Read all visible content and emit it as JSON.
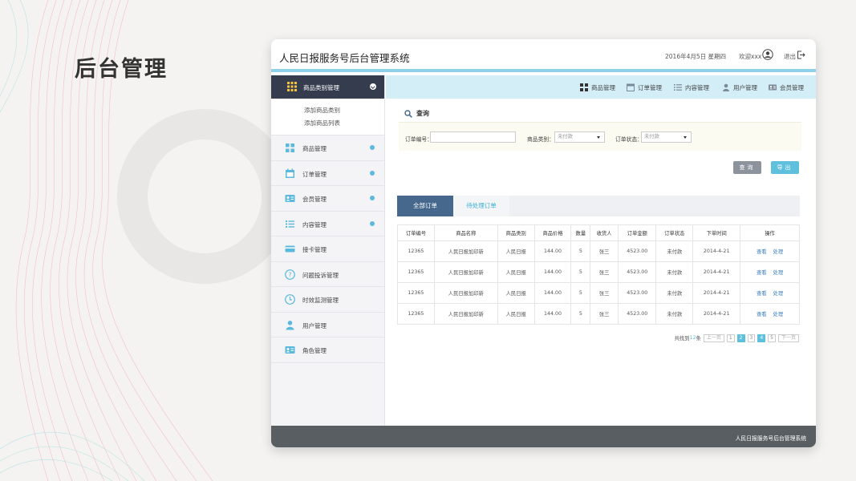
{
  "slide": {
    "title": "后台管理"
  },
  "app": {
    "title": "人民日报服务号后台管理系统",
    "date": "2016年4月5日 星期四",
    "welcome": "欢迎xxx",
    "logout": "退出"
  },
  "sidebar": {
    "active": {
      "label": "商品类别管理",
      "icon": "grid-icon"
    },
    "sub_items": [
      {
        "label": "添加商品类别"
      },
      {
        "label": "添加商品列表"
      }
    ],
    "items": [
      {
        "label": "商品管理",
        "icon": "apps-icon"
      },
      {
        "label": "订单管理",
        "icon": "calendar-icon"
      },
      {
        "label": "会员管理",
        "icon": "id-card-icon"
      },
      {
        "label": "内容管理",
        "icon": "list-icon"
      },
      {
        "label": "接卡管理",
        "icon": "credit-card-icon"
      },
      {
        "label": "问题投诉管理",
        "icon": "question-icon"
      },
      {
        "label": "时效监测管理",
        "icon": "clock-icon"
      },
      {
        "label": "用户管理",
        "icon": "user-icon"
      },
      {
        "label": "角色管理",
        "icon": "role-card-icon"
      }
    ]
  },
  "topnav": {
    "items": [
      {
        "label": "商品管理"
      },
      {
        "label": "订单管理"
      },
      {
        "label": "内容管理"
      },
      {
        "label": "用户管理"
      },
      {
        "label": "会员管理"
      }
    ]
  },
  "query": {
    "title": "查询",
    "order_no_label": "订单编号：",
    "order_no_value": "",
    "category_label": "商品类别：",
    "category_value": "未付款",
    "status_label": "订单状态：",
    "status_value": "未付款",
    "search_button": "查询",
    "export_button": "导出"
  },
  "tabs": [
    {
      "label": "全部订单"
    },
    {
      "label": "待处理订单"
    }
  ],
  "table": {
    "headers": [
      "订单编号",
      "商品名称",
      "商品类别",
      "商品价格",
      "数量",
      "收货人",
      "订单金额",
      "订单状态",
      "下单时间",
      "操作"
    ],
    "rows": [
      [
        "12365",
        "人民日报加印新",
        "人民日报",
        "144.00",
        "5",
        "张三",
        "4523.00",
        "未付款",
        "2014-4-21"
      ],
      [
        "12365",
        "人民日报加印新",
        "人民日报",
        "144.00",
        "5",
        "张三",
        "4523.00",
        "未付款",
        "2014-4-21"
      ],
      [
        "12365",
        "人民日报加印新",
        "人民日报",
        "144.00",
        "5",
        "张三",
        "4523.00",
        "未付款",
        "2014-4-21"
      ],
      [
        "12365",
        "人民日报加印新",
        "人民日报",
        "144.00",
        "5",
        "张三",
        "4523.00",
        "未付款",
        "2014-4-21"
      ]
    ],
    "actions": {
      "view": "查看",
      "handle": "处理"
    }
  },
  "pager": {
    "total_prefix": "共找到",
    "total": "12",
    "total_suffix": "条",
    "prev": "上一页",
    "pages": [
      "1",
      "2",
      "3",
      "4",
      "5"
    ],
    "current": "2",
    "next": "下一页"
  },
  "footer": {
    "text": "人民日报服务号后台管理系统"
  },
  "colors": {
    "accent": "#5ec0dd",
    "sidebar_active": "#353c4e",
    "tab_active": "#46688c",
    "footer": "#595e63"
  }
}
